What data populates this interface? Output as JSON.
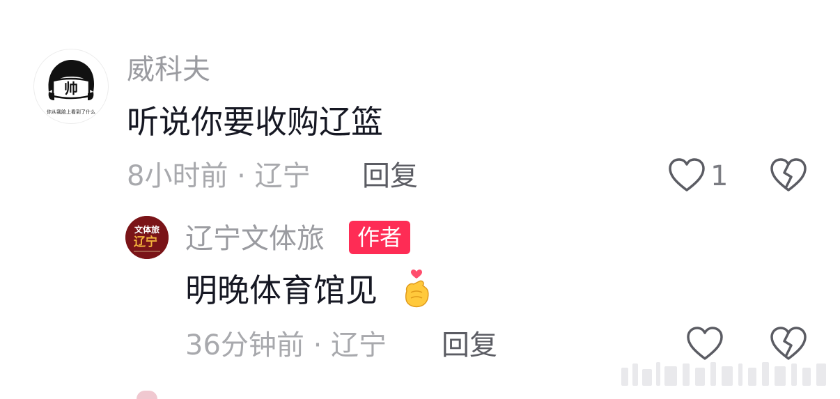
{
  "comments": [
    {
      "username": "威科夫",
      "avatar_text": "帅",
      "avatar_caption": "你从我脸上看到了什么",
      "text": "听说你要收购辽篮",
      "meta": "8小时前 · 辽宁",
      "reply_label": "回复",
      "like_count": "1"
    }
  ],
  "reply": {
    "username": "辽宁文体旅",
    "avatar_text_top": "文体旅",
    "avatar_text_bottom": "辽宁",
    "author_badge": "作者",
    "text": "明晚体育馆见",
    "emoji": "🫰",
    "meta": "36分钟前 · 辽宁",
    "reply_label": "回复"
  },
  "colors": {
    "badge": "#fe2c55",
    "muted": "#a8a9ad",
    "text": "#161823",
    "heart_stroke": "#5b5c63"
  },
  "icons": [
    "heart-outline-icon",
    "broken-heart-icon",
    "finger-heart-emoji"
  ]
}
